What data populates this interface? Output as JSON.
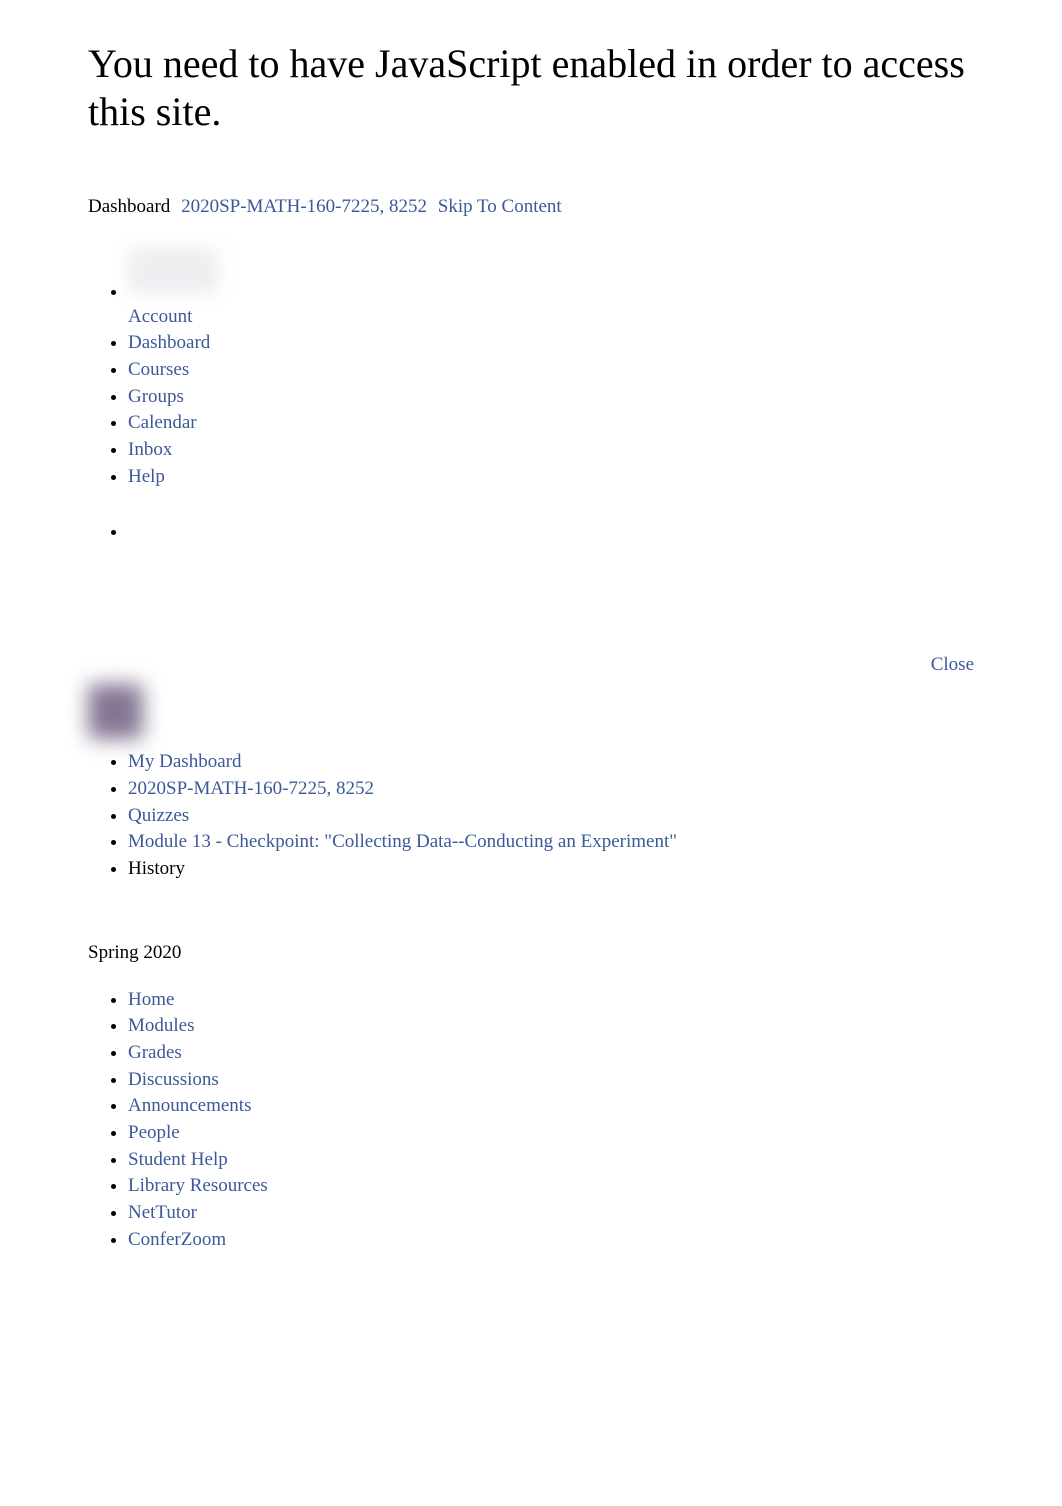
{
  "heading": "You need to have JavaScript enabled in order to access this site.",
  "top_breadcrumb": {
    "dashboard_label": "Dashboard",
    "course_link": "2020SP-MATH-160-7225, 8252",
    "skip_link": "Skip To Content"
  },
  "global_nav": {
    "account": "Account",
    "dashboard": "Dashboard",
    "courses": "Courses",
    "groups": "Groups",
    "calendar": "Calendar",
    "inbox": "Inbox",
    "help": "Help"
  },
  "close_label": "Close",
  "breadcrumbs": {
    "my_dashboard": "My Dashboard",
    "course": "2020SP-MATH-160-7225, 8252",
    "quizzes": "Quizzes",
    "quiz_title": "Module 13 - Checkpoint: \"Collecting Data--Conducting an Experiment\"",
    "history": "History"
  },
  "term": "Spring 2020",
  "course_nav": {
    "home": "Home",
    "modules": "Modules",
    "grades": "Grades",
    "discussions": "Discussions",
    "announcements": "Announcements",
    "people": "People",
    "student_help": "Student Help",
    "library_resources": "Library Resources",
    "nettutor": "NetTutor",
    "conferzoom": "ConferZoom"
  }
}
